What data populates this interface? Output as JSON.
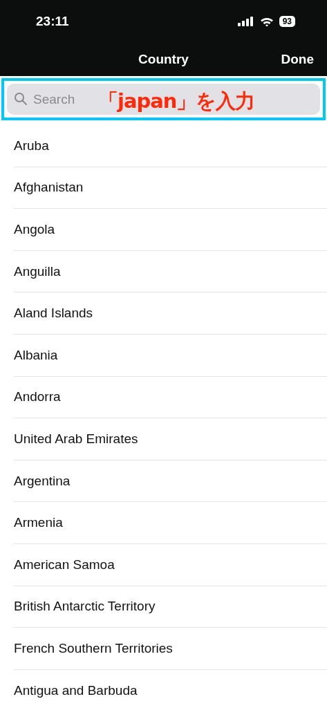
{
  "status_bar": {
    "time": "23:11",
    "battery": "93"
  },
  "nav_bar": {
    "title": "Country",
    "done": "Done"
  },
  "search": {
    "placeholder": "Search",
    "annotation": "「japan」を入力"
  },
  "countries": [
    {
      "name": "Aruba"
    },
    {
      "name": "Afghanistan"
    },
    {
      "name": "Angola"
    },
    {
      "name": "Anguilla"
    },
    {
      "name": "Aland Islands"
    },
    {
      "name": "Albania"
    },
    {
      "name": "Andorra"
    },
    {
      "name": "United Arab Emirates"
    },
    {
      "name": "Argentina"
    },
    {
      "name": "Armenia"
    },
    {
      "name": "American Samoa"
    },
    {
      "name": "British Antarctic Territory"
    },
    {
      "name": "French Southern Territories"
    },
    {
      "name": "Antigua and Barbuda"
    }
  ]
}
